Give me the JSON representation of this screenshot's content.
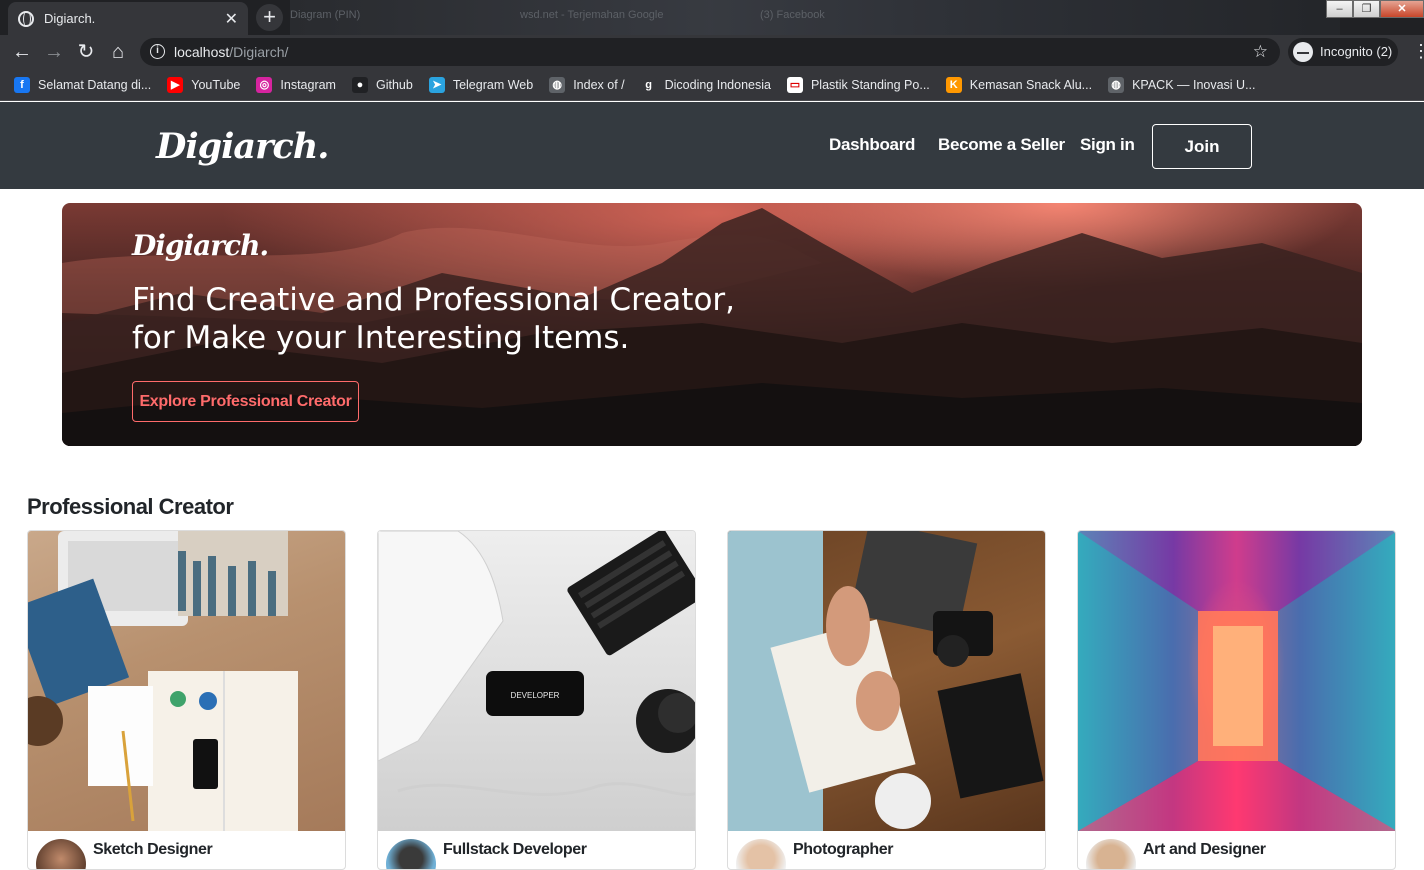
{
  "browser": {
    "tab_title": "Digiarch.",
    "tab_close": "✕",
    "new_tab": "+",
    "ghost_tabs": [
      "Diagram (PIN)",
      "wsd.net - Terjemahan Google",
      "(3) Facebook"
    ],
    "url_host": "localhost",
    "url_path": "/Digiarch/",
    "incognito_label": "Incognito (2)",
    "window_buttons": [
      "‒",
      "❐",
      "✕"
    ]
  },
  "bookmarks": [
    {
      "label": "Selamat Datang di...",
      "icon": "facebook-icon",
      "color": "#1877f2",
      "glyph": "f"
    },
    {
      "label": "YouTube",
      "icon": "youtube-icon",
      "color": "#ff0000",
      "glyph": "▶"
    },
    {
      "label": "Instagram",
      "icon": "instagram-icon",
      "color": "#d6249f",
      "glyph": "◎"
    },
    {
      "label": "Github",
      "icon": "github-icon",
      "color": "#202124",
      "glyph": "●"
    },
    {
      "label": "Telegram Web",
      "icon": "telegram-icon",
      "color": "#2aa3df",
      "glyph": "➤"
    },
    {
      "label": "Index of /",
      "icon": "globe-icon",
      "color": "#5f6368",
      "glyph": "◍"
    },
    {
      "label": "Dicoding Indonesia",
      "icon": "dicoding-icon",
      "color": "#35363a",
      "glyph": "g"
    },
    {
      "label": "Plastik Standing Po...",
      "icon": "plastik-icon",
      "color": "#ffffff",
      "glyph": "▭"
    },
    {
      "label": "Kemasan Snack Alu...",
      "icon": "kemasan-icon",
      "color": "#ff9800",
      "glyph": "K"
    },
    {
      "label": "KPACK — Inovasi U...",
      "icon": "globe-icon",
      "color": "#5f6368",
      "glyph": "◍"
    }
  ],
  "site": {
    "logo": "Digiarch.",
    "nav": {
      "dashboard": "Dashboard",
      "seller": "Become a Seller",
      "signin": "Sign in",
      "join": "Join"
    }
  },
  "hero": {
    "logo": "Digiarch.",
    "headline_line1": "Find Creative and Professional Creator,",
    "headline_line2": "for Make your Interesting Items.",
    "cta": "Explore Professional Creator",
    "accent": "#ff6b6b"
  },
  "section": {
    "title": "Professional Creator",
    "cards": [
      {
        "title": "Sketch Designer"
      },
      {
        "title": "Fullstack Developer",
        "device_label": "DEVELOPER"
      },
      {
        "title": "Photographer"
      },
      {
        "title": "Art and Designer"
      }
    ]
  },
  "colors": {
    "header_bg": "#343a40",
    "chrome_bg": "#35363a",
    "tabbar_bg": "#202124"
  }
}
